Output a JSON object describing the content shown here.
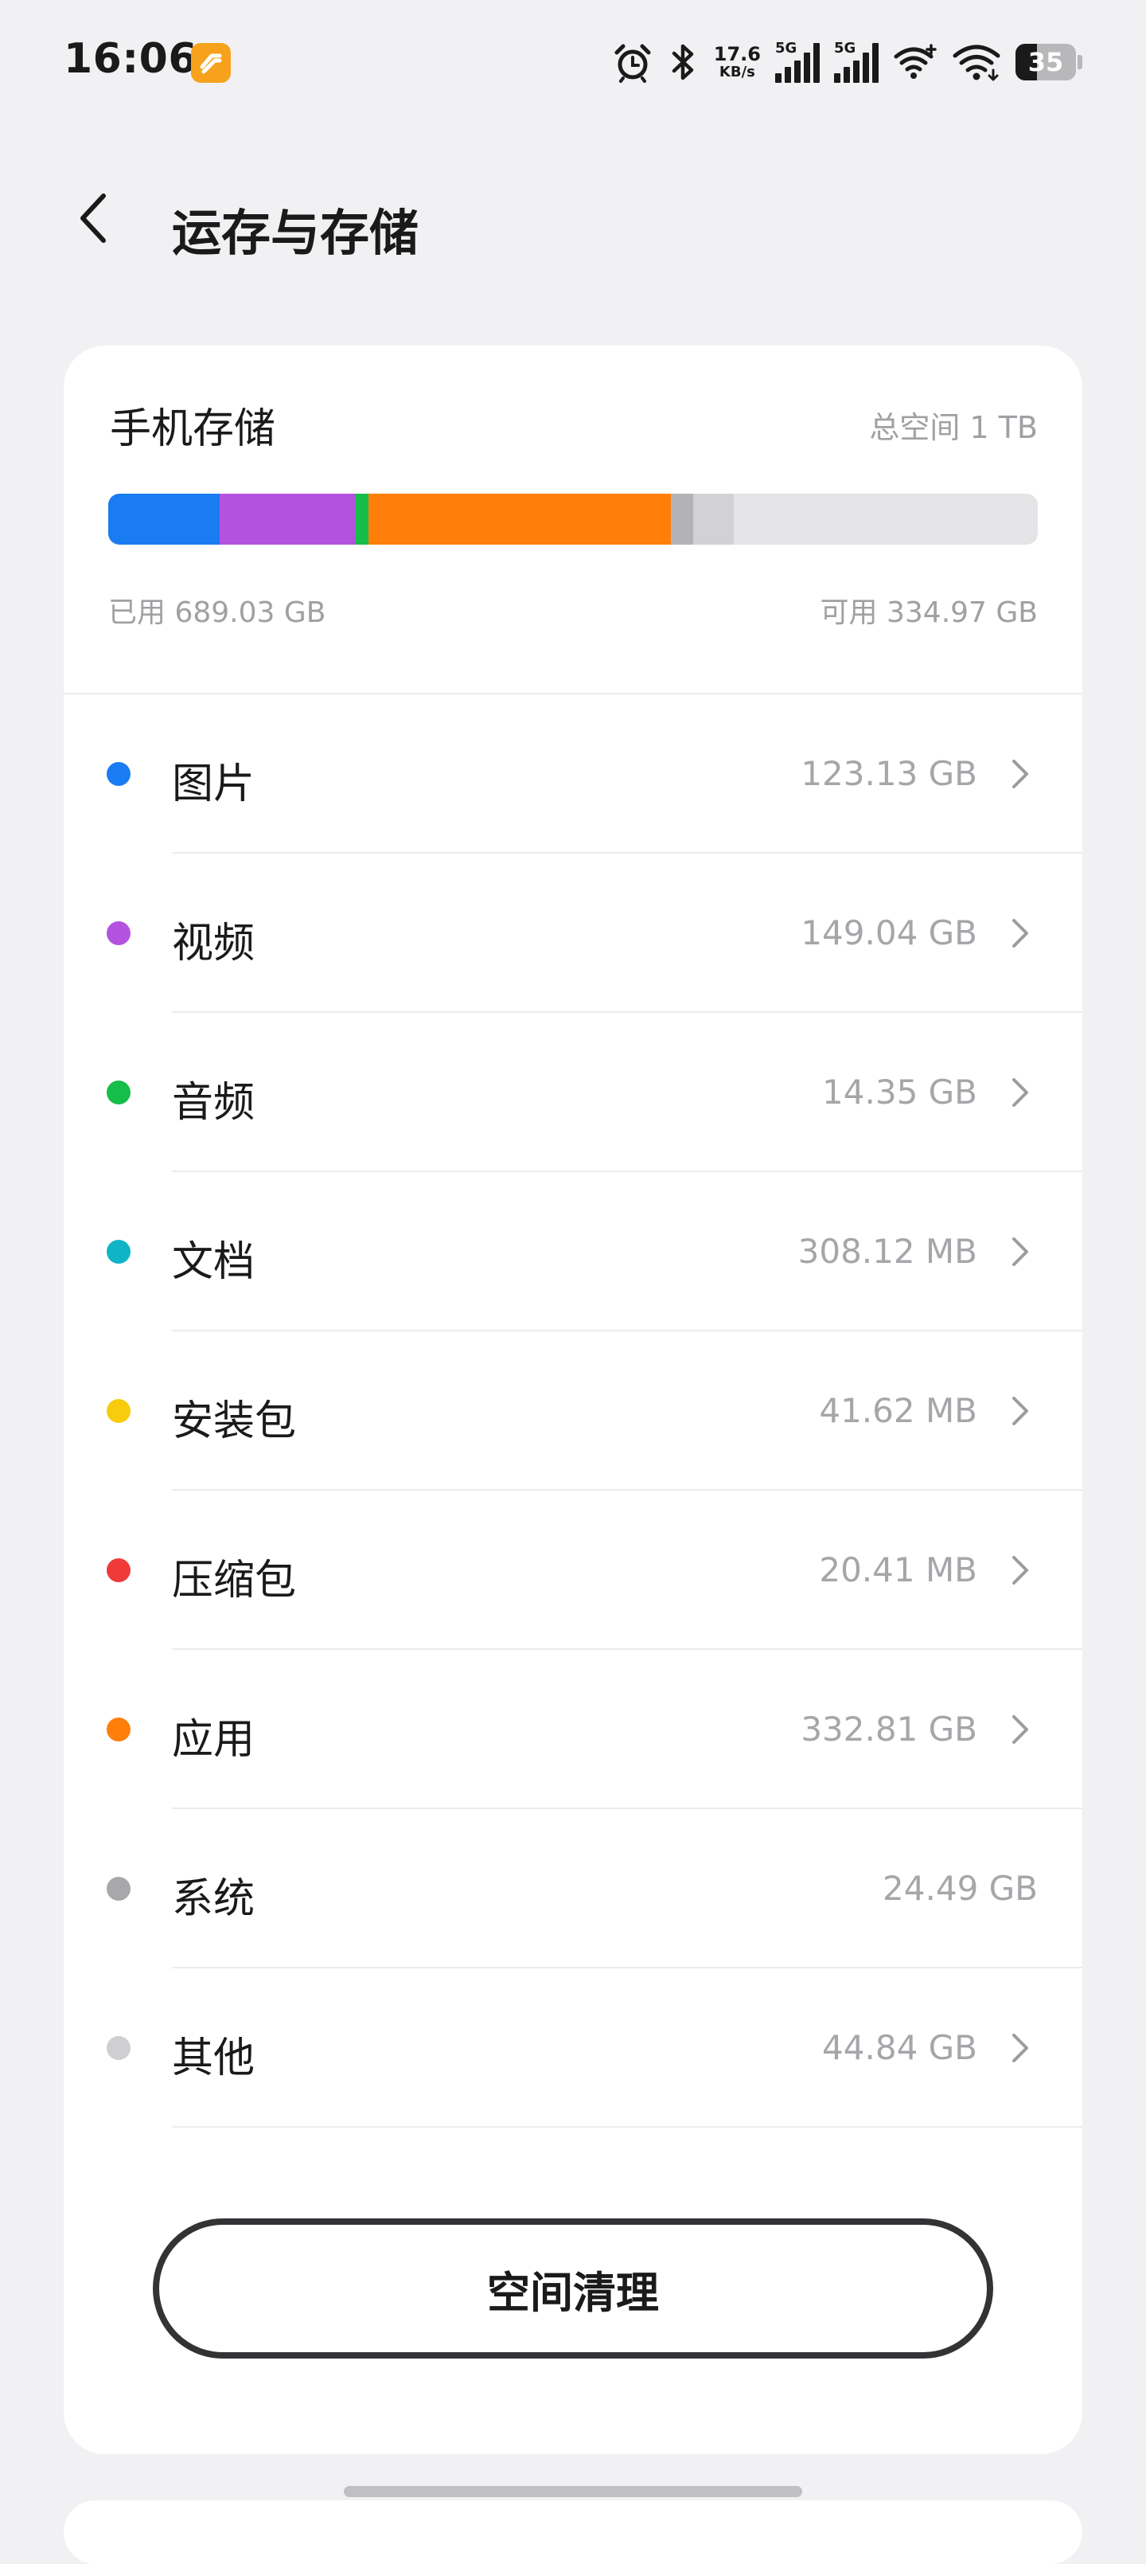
{
  "status_bar": {
    "time": "16:06",
    "app_icon": "orange-app-notification-icon",
    "alarm_icon": "alarm-clock-icon",
    "bluetooth_icon": "bluetooth-icon",
    "net_speed_value": "17.6",
    "net_speed_unit": "KB/s",
    "sim1_label": "5G",
    "sim2_label": "5G",
    "battery_level": "35",
    "battery_percent": 35
  },
  "header": {
    "back_icon": "chevron-left-icon",
    "title": "运存与存储"
  },
  "storage": {
    "title": "手机存储",
    "total_space": "总空间 1 TB",
    "used_label": "已用 689.03 GB",
    "free_label": "可用 334.97 GB",
    "usage_percent_used": 67.3,
    "bar_segments": [
      {
        "name": "图片",
        "value_gb": 123.13,
        "color": "#1a7cf2"
      },
      {
        "name": "视频",
        "value_gb": 149.04,
        "color": "#b452e0"
      },
      {
        "name": "音频",
        "value_gb": 14.35,
        "color": "#16bd48"
      },
      {
        "name": "文档",
        "value_gb": 0.30812,
        "color": "#0fb4c6"
      },
      {
        "name": "安装包",
        "value_gb": 0.04162,
        "color": "#f8cc0c"
      },
      {
        "name": "压缩包",
        "value_gb": 0.02041,
        "color": "#f03a3a"
      },
      {
        "name": "应用",
        "value_gb": 332.81,
        "color": "#ff7f0a"
      },
      {
        "name": "系统",
        "value_gb": 24.49,
        "color": "#b3b3b6"
      },
      {
        "name": "其他",
        "value_gb": 44.84,
        "color": "#d2d2d4"
      }
    ],
    "total_gb": 1024
  },
  "categories": [
    {
      "label": "图片",
      "size": "123.13 GB",
      "color": "#1a7cf2",
      "chevron": true
    },
    {
      "label": "视频",
      "size": "149.04 GB",
      "color": "#b452e0",
      "chevron": true
    },
    {
      "label": "音频",
      "size": "14.35 GB",
      "color": "#16bd48",
      "chevron": true
    },
    {
      "label": "文档",
      "size": "308.12 MB",
      "color": "#0fb4c6",
      "chevron": true
    },
    {
      "label": "安装包",
      "size": "41.62 MB",
      "color": "#f8cc0c",
      "chevron": true
    },
    {
      "label": "压缩包",
      "size": "20.41 MB",
      "color": "#f03a3a",
      "chevron": true
    },
    {
      "label": "应用",
      "size": "332.81 GB",
      "color": "#ff7f0a",
      "chevron": true
    },
    {
      "label": "系统",
      "size": "24.49 GB",
      "color": "#a8a8ab",
      "chevron": false
    },
    {
      "label": "其他",
      "size": "44.84 GB",
      "color": "#cfcfd2",
      "chevron": true
    }
  ],
  "clean_button_label": "空间清理"
}
